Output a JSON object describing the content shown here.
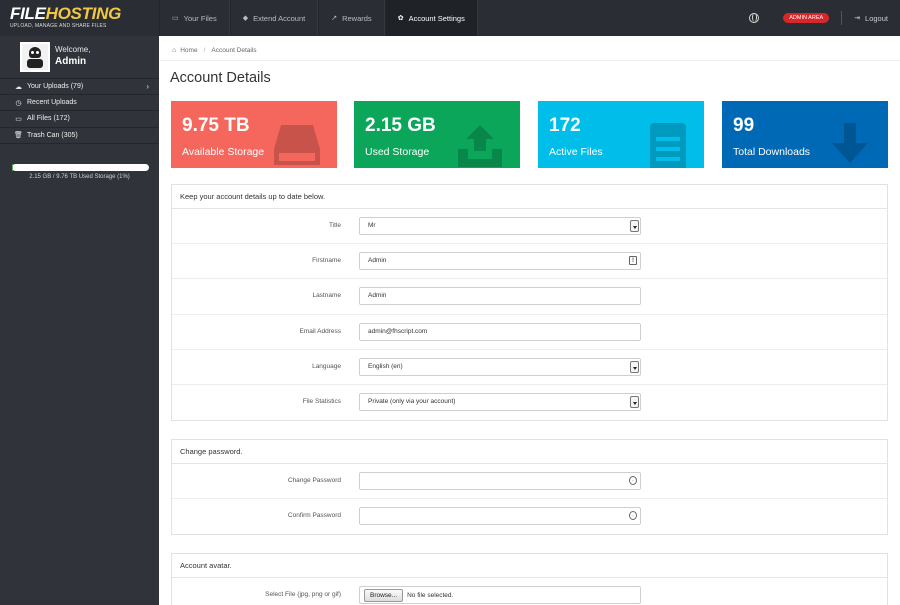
{
  "brand": {
    "name_a": "FILE",
    "name_b": "HOSTING",
    "tagline": "UPLOAD, MANAGE AND SHARE FILES"
  },
  "topnav": [
    {
      "label": "Your Files",
      "icon": "folder-icon",
      "glyph": "▭",
      "active": false
    },
    {
      "label": "Extend Account",
      "icon": "tag-icon",
      "glyph": "◆",
      "active": false
    },
    {
      "label": "Rewards",
      "icon": "chart-icon",
      "glyph": "↗",
      "active": false
    },
    {
      "label": "Account Settings",
      "icon": "gear-icon",
      "glyph": "✿",
      "active": true
    }
  ],
  "topright": {
    "badge": "ADMIN AREA",
    "logout": "Logout",
    "logout_glyph": "⇥"
  },
  "sidebar": {
    "welcome": "Welcome,",
    "username": "Admin",
    "items": [
      {
        "label": "Your Uploads (79)",
        "icon": "cloud-upload-icon",
        "glyph": "☁",
        "has_chevron": true
      },
      {
        "label": "Recent Uploads",
        "icon": "clock-icon",
        "glyph": "◷",
        "has_chevron": false
      },
      {
        "label": "All Files (172)",
        "icon": "drive-icon",
        "glyph": "▭",
        "has_chevron": false
      },
      {
        "label": "Trash Can (305)",
        "icon": "trash-icon",
        "glyph": "🗑",
        "has_chevron": false
      }
    ],
    "chevron": "›",
    "storage_text": "2.15 GB / 9.76 TB Used Storage (1%)",
    "storage_percent": 1
  },
  "breadcrumb": {
    "home": "Home",
    "separator": "/",
    "current": "Account Details"
  },
  "page_title": "Account Details",
  "stats": [
    {
      "value": "9.75 TB",
      "label": "Available Storage",
      "icon": "drive-icon",
      "color": "#f5665d"
    },
    {
      "value": "2.15 GB",
      "label": "Used Storage",
      "icon": "upload-icon",
      "color": "#0ca65b"
    },
    {
      "value": "172",
      "label": "Active Files",
      "icon": "file-icon",
      "color": "#00bde9"
    },
    {
      "value": "99",
      "label": "Total Downloads",
      "icon": "download-icon",
      "color": "#0069b5"
    }
  ],
  "details_form": {
    "heading": "Keep your account details up to date below.",
    "fields": [
      {
        "label": "Title",
        "value": "Mr"
      },
      {
        "label": "Firstname",
        "value": "Admin"
      },
      {
        "label": "Lastname",
        "value": "Admin"
      },
      {
        "label": "Email Address",
        "value": "admin@fhscript.com"
      },
      {
        "label": "Language",
        "value": "English (en)"
      },
      {
        "label": "File Statistics",
        "value": "Private (only via your account)"
      }
    ]
  },
  "password_form": {
    "heading": "Change password.",
    "fields": [
      {
        "label": "Change Password",
        "value": ""
      },
      {
        "label": "Confirm Password",
        "value": ""
      }
    ]
  },
  "avatar_form": {
    "heading": "Account avatar.",
    "file_label": "Select File (jpg, png or gif)",
    "browse": "Browse...",
    "no_file": "No file selected."
  }
}
